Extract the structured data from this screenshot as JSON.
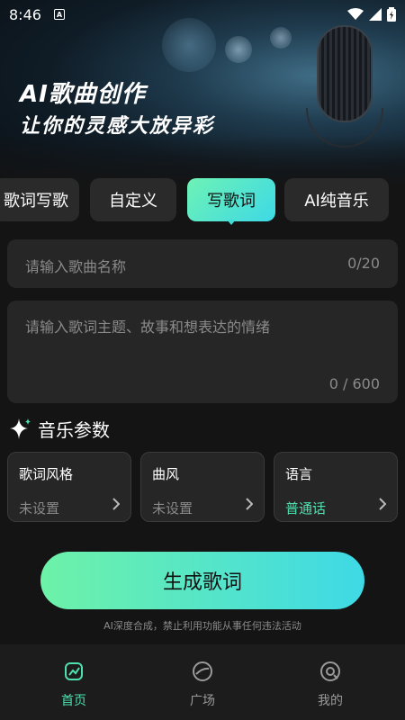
{
  "status_bar": {
    "time": "8:46",
    "indicator": "A"
  },
  "hero": {
    "title": "AI歌曲创作",
    "subtitle": "让你的灵感大放异彩"
  },
  "tabs": [
    {
      "label": "歌词写歌",
      "active": false
    },
    {
      "label": "自定义",
      "active": false
    },
    {
      "label": "写歌词",
      "active": true
    },
    {
      "label": "AI纯音乐",
      "active": false
    }
  ],
  "song_name": {
    "placeholder": "请输入歌曲名称",
    "count": "0/20"
  },
  "lyrics_input": {
    "placeholder": "请输入歌词主题、故事和想表达的情绪",
    "count": "0 / 600"
  },
  "section": {
    "title": "音乐参数"
  },
  "params": [
    {
      "label": "歌词风格",
      "value": "未设置"
    },
    {
      "label": "曲风",
      "value": "未设置"
    },
    {
      "label": "语言",
      "value": "普通话"
    }
  ],
  "generate_button": {
    "label": "生成歌词"
  },
  "disclaimer": "AI深度合成，禁止利用功能从事任何违法活动",
  "nav": [
    {
      "label": "首页",
      "icon": "home-icon",
      "active": true
    },
    {
      "label": "广场",
      "icon": "disc-icon",
      "active": false
    },
    {
      "label": "我的",
      "icon": "profile-icon",
      "active": false
    }
  ],
  "colors": {
    "accent": "#4ee0b0",
    "gradient_start": "#6ef2a8",
    "gradient_end": "#3ed9e6",
    "background": "#141414"
  }
}
